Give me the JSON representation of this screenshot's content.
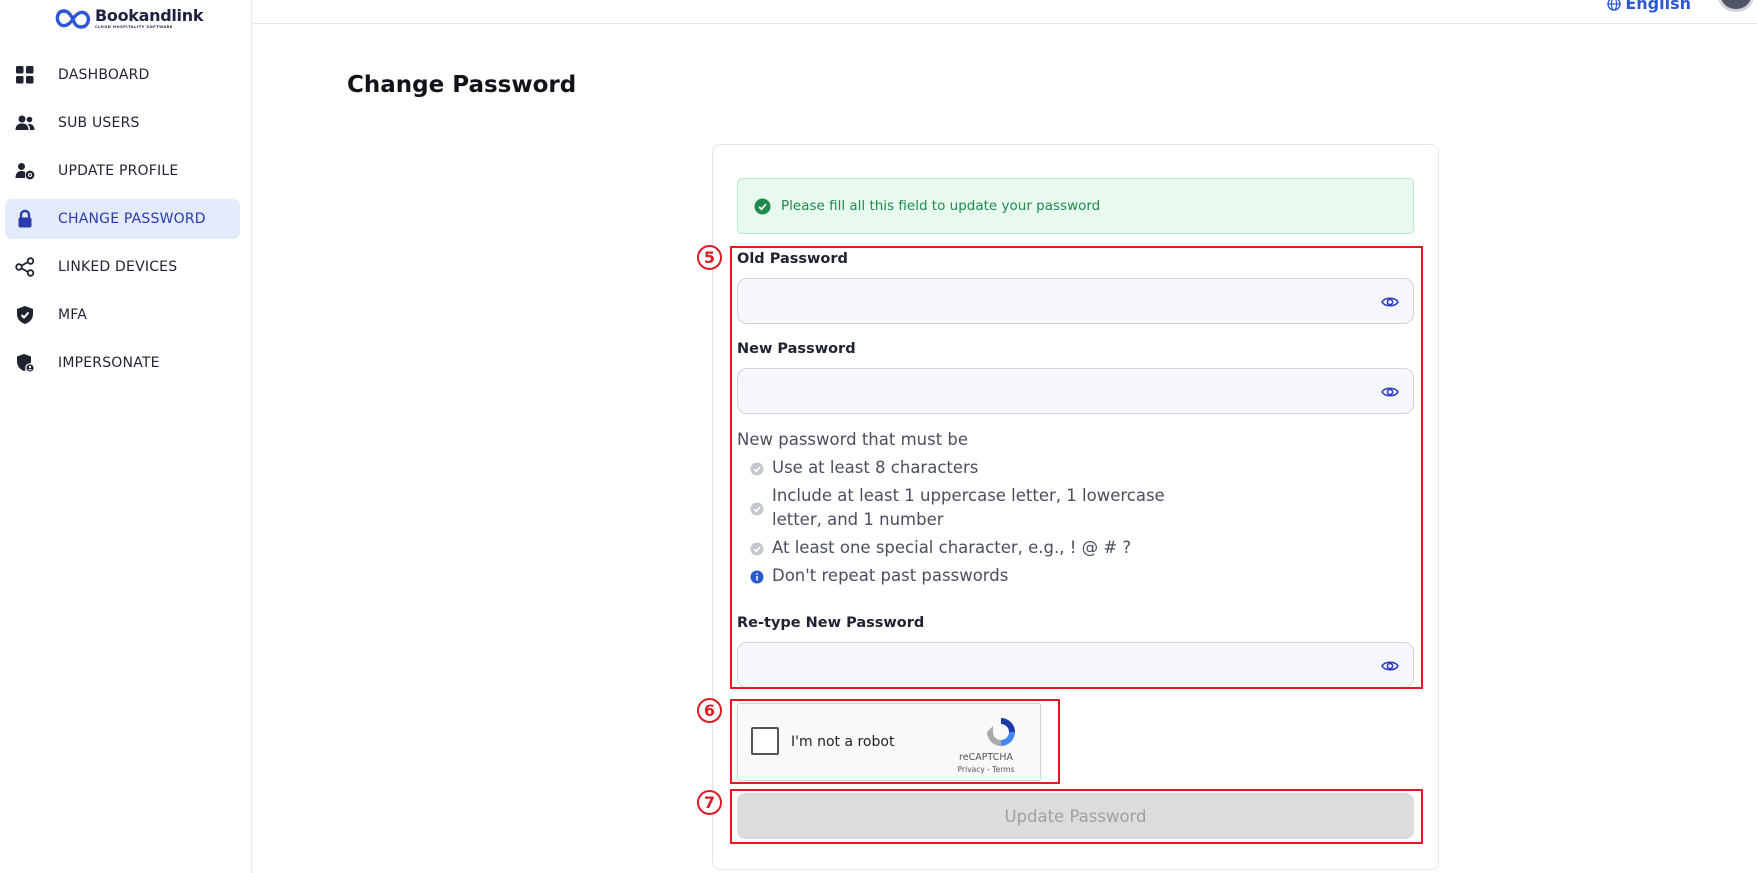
{
  "brand": {
    "name": "Bookandlink",
    "tagline": "CLOUD HOSPITALITY SOFTWARE"
  },
  "sidebar": {
    "items": [
      {
        "label": "DASHBOARD",
        "icon": "grid-icon",
        "active": false
      },
      {
        "label": "SUB USERS",
        "icon": "users-icon",
        "active": false
      },
      {
        "label": "UPDATE PROFILE",
        "icon": "user-gear-icon",
        "active": false
      },
      {
        "label": "CHANGE PASSWORD",
        "icon": "lock-icon",
        "active": true
      },
      {
        "label": "LINKED DEVICES",
        "icon": "share-nodes-icon",
        "active": false
      },
      {
        "label": "MFA",
        "icon": "shield-check-icon",
        "active": false
      },
      {
        "label": "IMPERSONATE",
        "icon": "shield-user-icon",
        "active": false
      }
    ]
  },
  "header": {
    "language": "English"
  },
  "page": {
    "title": "Change Password"
  },
  "form": {
    "alert": "Please fill all this field to update your password",
    "old_password": {
      "label": "Old Password",
      "value": ""
    },
    "new_password": {
      "label": "New Password",
      "value": ""
    },
    "requirements_title": "New password that must be",
    "requirements": [
      {
        "text": "Use at least 8 characters",
        "icon": "check-circle-icon"
      },
      {
        "text": "Include at least 1 uppercase letter, 1 lowercase",
        "text2": "letter, and 1 number",
        "icon": "check-circle-icon"
      },
      {
        "text": "At least one special character, e.g., ! @ # ?",
        "icon": "check-circle-icon"
      },
      {
        "text": "Don't repeat past passwords",
        "icon": "info-circle-icon"
      }
    ],
    "retype_password": {
      "label": "Re-type New Password",
      "value": ""
    },
    "recaptcha": {
      "label": "I'm not a robot",
      "brand": "reCAPTCHA",
      "links": "Privacy - Terms"
    },
    "submit_label": "Update Password"
  },
  "annotations": [
    "5",
    "6",
    "7"
  ],
  "colors": {
    "accent": "#2c57d6",
    "active_bg": "#e3ebfb",
    "alert_bg": "#e8f9ef",
    "alert_text": "#1f8a4c",
    "annotation": "#e01b24",
    "disabled_button": "#dcdcdc"
  }
}
